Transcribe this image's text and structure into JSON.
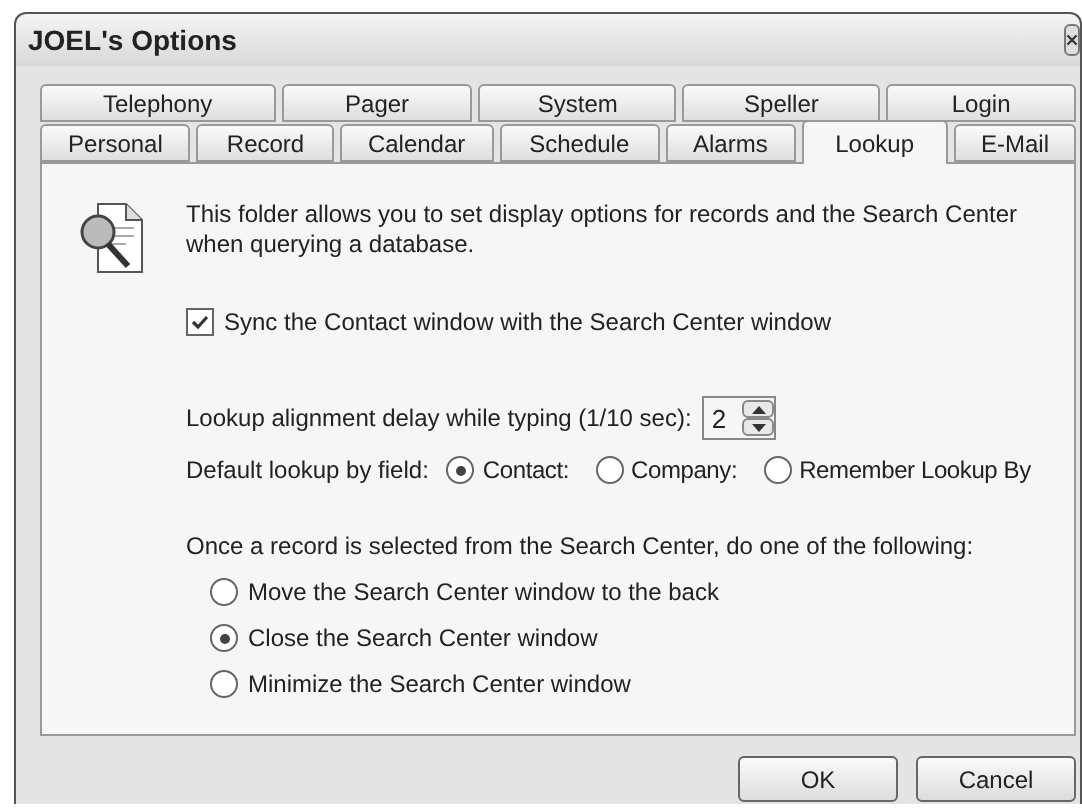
{
  "window": {
    "title": "JOEL's Options"
  },
  "tab_rows": [
    [
      {
        "label": "Telephony",
        "selected": false
      },
      {
        "label": "Pager",
        "selected": false
      },
      {
        "label": "System",
        "selected": false
      },
      {
        "label": "Speller",
        "selected": false
      },
      {
        "label": "Login",
        "selected": false
      }
    ],
    [
      {
        "label": "Personal",
        "selected": false
      },
      {
        "label": "Record",
        "selected": false
      },
      {
        "label": "Calendar",
        "selected": false
      },
      {
        "label": "Schedule",
        "selected": false
      },
      {
        "label": "Alarms",
        "selected": false
      },
      {
        "label": "Lookup",
        "selected": true
      },
      {
        "label": "E-Mail",
        "selected": false
      }
    ]
  ],
  "description": "This folder allows you to set display options for records and the Search Center when querying a database.",
  "sync": {
    "label": "Sync the Contact window with the Search Center window",
    "checked": true
  },
  "delay": {
    "label": "Lookup alignment delay while typing (1/10 sec):",
    "value": "2"
  },
  "default_lookup": {
    "label": "Default lookup by field:",
    "options": [
      {
        "label": "Contact:",
        "selected": true
      },
      {
        "label": "Company:",
        "selected": false
      },
      {
        "label": "Remember Lookup By",
        "selected": false
      }
    ]
  },
  "after_select": {
    "label": "Once a record is selected from the Search Center, do one of the following:",
    "options": [
      {
        "label": "Move the Search Center window to the back",
        "selected": false
      },
      {
        "label": "Close the Search Center window",
        "selected": true
      },
      {
        "label": "Minimize the Search Center window",
        "selected": false
      }
    ]
  },
  "buttons": [
    "OK",
    "Cancel"
  ]
}
